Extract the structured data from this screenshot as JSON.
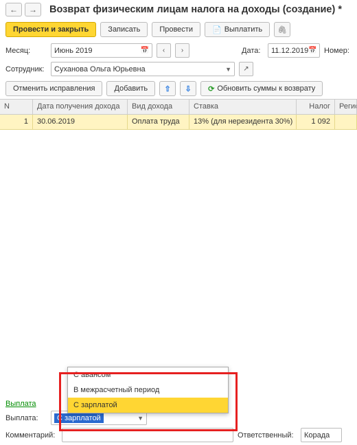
{
  "header": {
    "title": "Возврат физическим лицам налога на доходы (создание) *"
  },
  "toolbar": {
    "post_close": "Провести и закрыть",
    "save": "Записать",
    "post": "Провести",
    "pay": "Выплатить"
  },
  "form": {
    "month_label": "Месяц:",
    "month_value": "Июнь 2019",
    "date_label": "Дата:",
    "date_value": "11.12.2019",
    "number_label": "Номер:",
    "employee_label": "Сотрудник:",
    "employee_value": "Суханова Ольга Юрьевна"
  },
  "actions": {
    "cancel_fix": "Отменить исправления",
    "add": "Добавить",
    "refresh": "Обновить суммы к возврату"
  },
  "table": {
    "headers": {
      "n": "N",
      "date": "Дата получения дохода",
      "type": "Вид дохода",
      "rate": "Ставка",
      "tax": "Налог",
      "reg": "Регис"
    },
    "row1": {
      "n": "1",
      "date": "30.06.2019",
      "type": "Оплата труда",
      "rate": "13% (для нерезидента 30%)",
      "tax": "1 092"
    }
  },
  "bottom": {
    "payment_link": "Выплата",
    "payment_label": "Выплата:",
    "payment_value": "С зарплатой",
    "comment_label": "Комментарий:",
    "responsible_label": "Ответственный:",
    "responsible_value": "Корада"
  },
  "dropdown": {
    "opt1": "С авансом",
    "opt2": "В межрасчетный период",
    "opt3": "С зарплатой"
  }
}
